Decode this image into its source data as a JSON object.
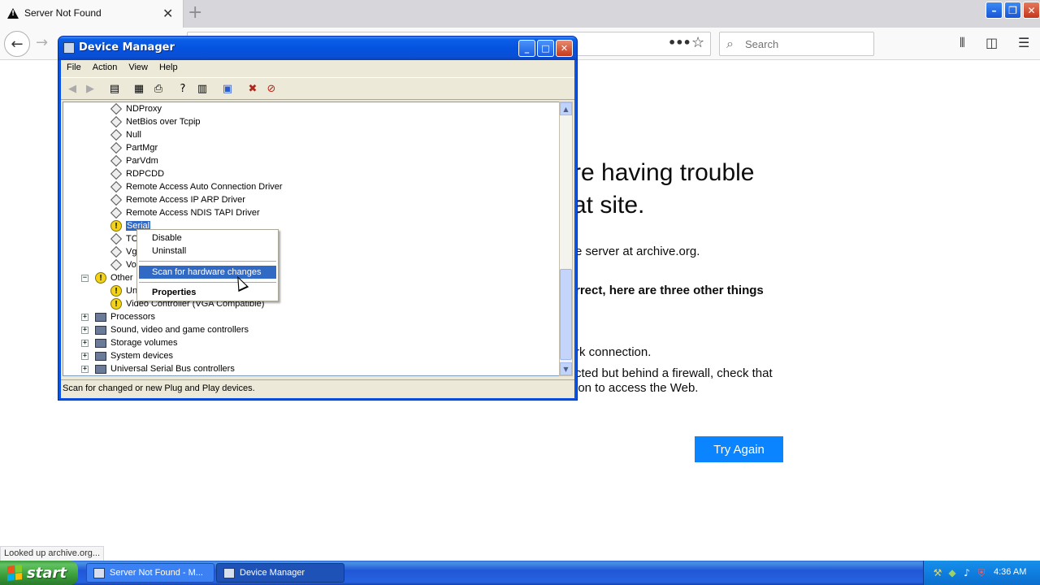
{
  "firefox": {
    "tab_title": "Server Not Found",
    "search_placeholder": "Search",
    "error_title_line1": "re having trouble",
    "error_title_line2": "at site.",
    "error_line1": "e server at archive.org.",
    "error_bold": "rrect, here are three other things",
    "error_item1": "rk connection.",
    "error_item2a": "cted but behind a firewall, check that",
    "error_item2b": "ion to access the Web.",
    "try_again": "Try Again",
    "status": "Looked up archive.org..."
  },
  "device_manager": {
    "title": "Device Manager",
    "menu": [
      "File",
      "Action",
      "View",
      "Help"
    ],
    "tree": [
      {
        "label": "NDProxy",
        "icon": "diamond"
      },
      {
        "label": "NetBios over Tcpip",
        "icon": "diamond"
      },
      {
        "label": "Null",
        "icon": "diamond"
      },
      {
        "label": "PartMgr",
        "icon": "diamond"
      },
      {
        "label": "ParVdm",
        "icon": "diamond"
      },
      {
        "label": "RDPCDD",
        "icon": "diamond"
      },
      {
        "label": "Remote Access Auto Connection Driver",
        "icon": "diamond"
      },
      {
        "label": "Remote Access IP ARP Driver",
        "icon": "diamond"
      },
      {
        "label": "Remote Access NDIS TAPI Driver",
        "icon": "diamond"
      },
      {
        "label": "Serial",
        "icon": "warning",
        "selected": true
      },
      {
        "label": "TC",
        "icon": "diamond"
      },
      {
        "label": "Vg",
        "icon": "diamond"
      },
      {
        "label": "Vo",
        "icon": "diamond"
      },
      {
        "label": "Other",
        "icon": "warning-category"
      },
      {
        "label": "Un",
        "icon": "warning"
      },
      {
        "label": "Video Controller (VGA Compatible)",
        "icon": "warning"
      },
      {
        "label": "Processors",
        "icon": "device"
      },
      {
        "label": "Sound, video and game controllers",
        "icon": "device"
      },
      {
        "label": "Storage volumes",
        "icon": "device"
      },
      {
        "label": "System devices",
        "icon": "device"
      },
      {
        "label": "Universal Serial Bus controllers",
        "icon": "device"
      }
    ],
    "context_menu": {
      "disable": "Disable",
      "uninstall": "Uninstall",
      "scan": "Scan for hardware changes",
      "properties": "Properties"
    },
    "status": "Scan for changed or new Plug and Play devices."
  },
  "taskbar": {
    "start": "start",
    "task1": "Server Not Found - M...",
    "task2": "Device Manager",
    "time": "4:36 AM"
  },
  "colors": {
    "accent": "#0a84ff",
    "xp_selection": "#316ac5",
    "xp_title": "#0453e0"
  }
}
